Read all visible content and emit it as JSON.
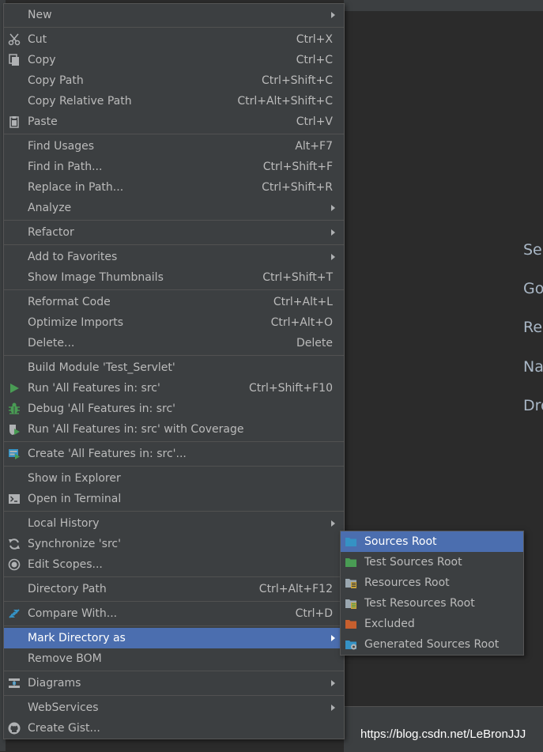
{
  "menu": {
    "new": {
      "label": "New"
    },
    "cut": {
      "label": "Cut",
      "shortcut": "Ctrl+X",
      "icon": "scissors-icon"
    },
    "copy": {
      "label": "Copy",
      "shortcut": "Ctrl+C",
      "icon": "copy-icon"
    },
    "copy_path": {
      "label": "Copy Path",
      "shortcut": "Ctrl+Shift+C"
    },
    "copy_relative_path": {
      "label": "Copy Relative Path",
      "shortcut": "Ctrl+Alt+Shift+C"
    },
    "paste": {
      "label": "Paste",
      "shortcut": "Ctrl+V",
      "icon": "clipboard-icon"
    },
    "find_usages": {
      "label": "Find Usages",
      "shortcut": "Alt+F7"
    },
    "find_in_path": {
      "label": "Find in Path...",
      "shortcut": "Ctrl+Shift+F"
    },
    "replace_in_path": {
      "label": "Replace in Path...",
      "shortcut": "Ctrl+Shift+R"
    },
    "analyze": {
      "label": "Analyze"
    },
    "refactor": {
      "label": "Refactor"
    },
    "add_to_favorites": {
      "label": "Add to Favorites"
    },
    "show_image_thumbnails": {
      "label": "Show Image Thumbnails",
      "shortcut": "Ctrl+Shift+T"
    },
    "reformat_code": {
      "label": "Reformat Code",
      "shortcut": "Ctrl+Alt+L"
    },
    "optimize_imports": {
      "label": "Optimize Imports",
      "shortcut": "Ctrl+Alt+O"
    },
    "delete": {
      "label": "Delete...",
      "shortcut": "Delete"
    },
    "build_module": {
      "label": "Build Module 'Test_Servlet'"
    },
    "run": {
      "label": "Run 'All Features in: src'",
      "shortcut": "Ctrl+Shift+F10",
      "icon": "run-icon"
    },
    "debug": {
      "label": "Debug 'All Features in: src'",
      "icon": "bug-icon"
    },
    "run_coverage": {
      "label": "Run 'All Features in: src' with Coverage",
      "icon": "coverage-icon"
    },
    "create": {
      "label": "Create 'All Features in: src'...",
      "icon": "run-config-icon"
    },
    "show_in_explorer": {
      "label": "Show in Explorer"
    },
    "open_in_terminal": {
      "label": "Open in Terminal",
      "icon": "terminal-icon"
    },
    "local_history": {
      "label": "Local History"
    },
    "synchronize": {
      "label": "Synchronize 'src'",
      "icon": "sync-icon"
    },
    "edit_scopes": {
      "label": "Edit Scopes...",
      "icon": "scope-icon"
    },
    "directory_path": {
      "label": "Directory Path",
      "shortcut": "Ctrl+Alt+F12"
    },
    "compare_with": {
      "label": "Compare With...",
      "shortcut": "Ctrl+D",
      "icon": "compare-icon"
    },
    "mark_directory_as": {
      "label": "Mark Directory as"
    },
    "remove_bom": {
      "label": "Remove BOM"
    },
    "diagrams": {
      "label": "Diagrams",
      "icon": "diagram-icon"
    },
    "webservices": {
      "label": "WebServices"
    },
    "create_gist": {
      "label": "Create Gist...",
      "icon": "github-icon"
    }
  },
  "submenu": {
    "sources_root": {
      "label": "Sources Root",
      "icon": "folder-blue-icon"
    },
    "test_sources_root": {
      "label": "Test Sources Root",
      "icon": "folder-green-icon"
    },
    "resources_root": {
      "label": "Resources Root",
      "icon": "folder-resources-icon"
    },
    "test_resources_root": {
      "label": "Test Resources Root",
      "icon": "folder-test-resources-icon"
    },
    "excluded": {
      "label": "Excluded",
      "icon": "folder-orange-icon"
    },
    "generated_sources_root": {
      "label": "Generated Sources Root",
      "icon": "folder-generated-icon"
    }
  },
  "background": {
    "hints": [
      "Sea",
      "Go",
      "Re",
      "Na",
      "Dro"
    ],
    "watermark": "https://blog.csdn.net/LeBronJJJ"
  },
  "colors": {
    "menu_bg": "#3c3f41",
    "highlight": "#4b6eaf",
    "text": "#bbbbbb",
    "editor_bg": "#2b2b2b"
  }
}
